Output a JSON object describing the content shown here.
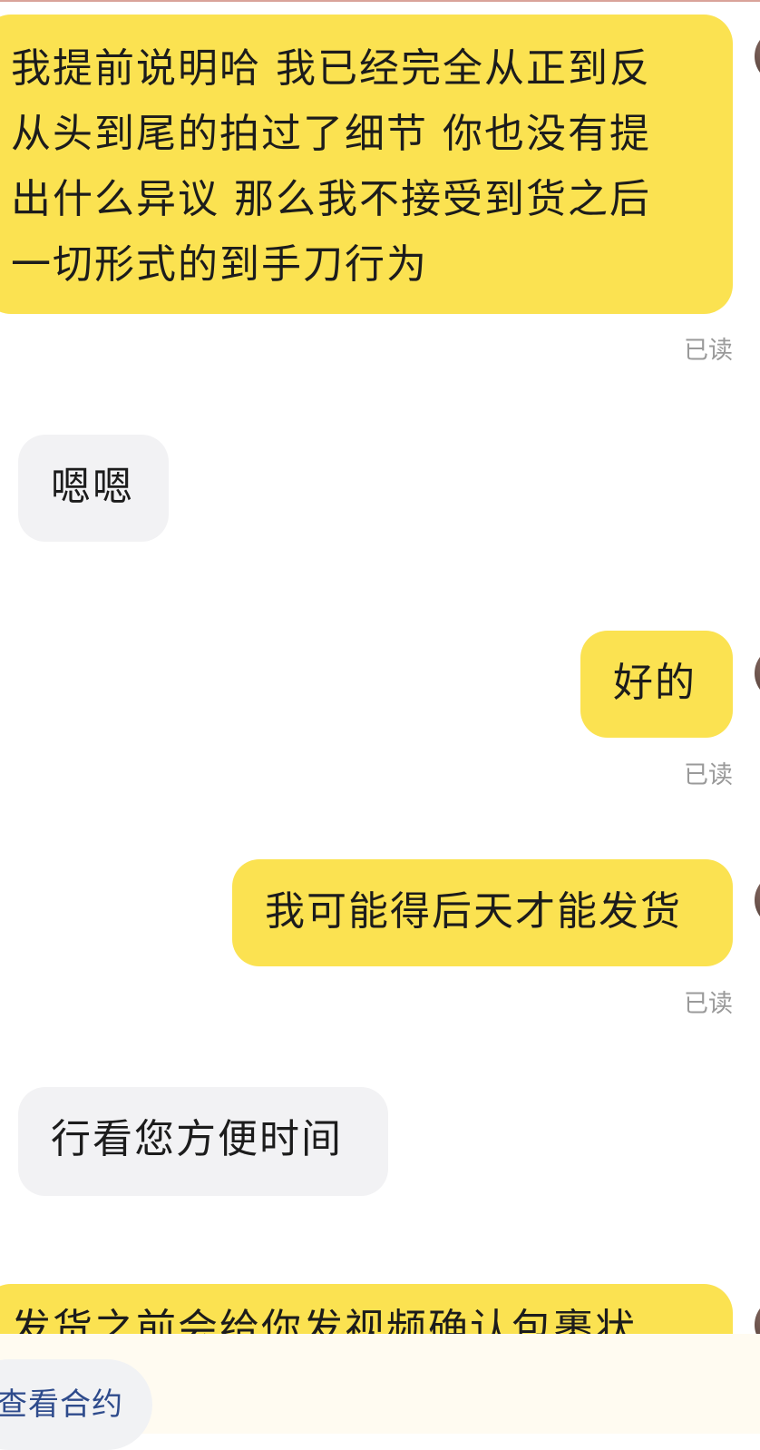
{
  "messages": [
    {
      "from": "me",
      "lines": [
        "我提前说明哈 我已经完全从正到反",
        "从头到尾的拍过了细节 你也没有提",
        "出什么异议 那么我不接受到货之后",
        "一切形式的到手刀行为"
      ],
      "status": "已读"
    },
    {
      "from": "other",
      "text": "嗯嗯"
    },
    {
      "from": "me",
      "text": "好的",
      "status": "已读"
    },
    {
      "from": "me",
      "text": "我可能得后天才能发货",
      "status": "已读"
    },
    {
      "from": "other",
      "text": "行看您方便时间"
    },
    {
      "from": "me",
      "text": "发货之前会给你发视频确认包裹状"
    }
  ],
  "bottom_bar": {
    "contract_button": "查看合约"
  },
  "colors": {
    "outgoing_bubble": "#fbe251",
    "incoming_bubble": "#f2f2f4",
    "read_status": "#9a9a9a",
    "link_text": "#2e4b8c"
  }
}
